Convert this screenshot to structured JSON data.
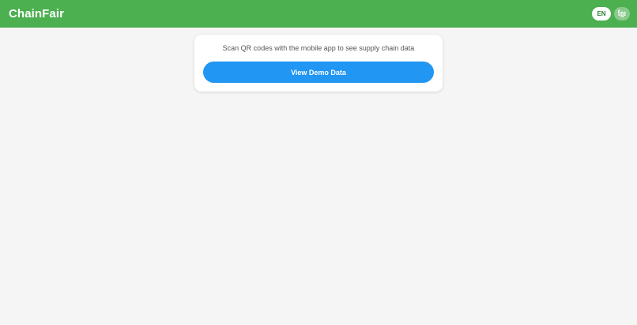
{
  "header": {
    "brand": "ChainFair",
    "languages": [
      {
        "label": "EN",
        "active": true
      },
      {
        "label": "ខ្មែរ",
        "active": false
      }
    ]
  },
  "card": {
    "message": "Scan QR codes with the mobile app to see supply chain data",
    "button_label": "View Demo Data"
  },
  "colors": {
    "header_bg": "#4caf50",
    "primary_button": "#2196f3",
    "page_bg": "#f5f5f5"
  }
}
